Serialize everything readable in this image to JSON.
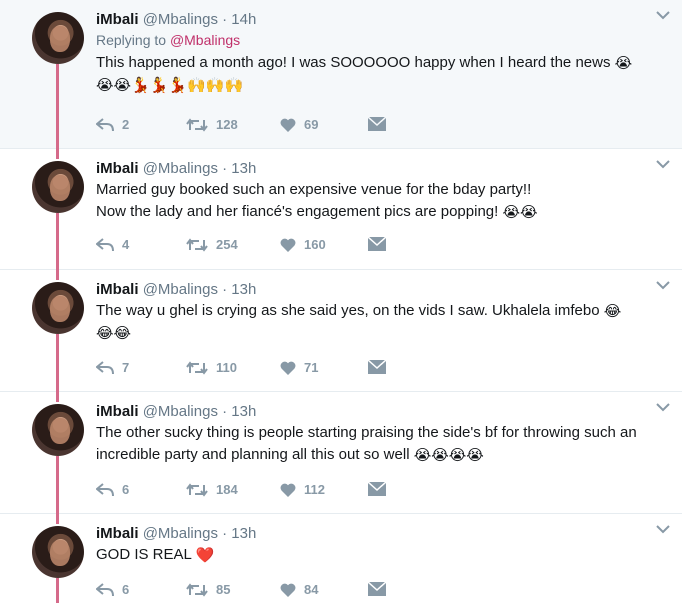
{
  "colors": {
    "thread": "#d56a8a",
    "muted": "#657786",
    "action": "#8899a6",
    "link": "#c0306a"
  },
  "tweets": [
    {
      "name": "iMbali",
      "handle": "@Mbalings",
      "time": "14h",
      "replying_label": "Replying to",
      "replying_to": "@Mbalings",
      "text1": "This happened a month ago! I was SOOOOOO happy when I heard the news",
      "emoji1": "😭",
      "emoji2": "😭😭💃💃💃🙌🙌🙌",
      "replies": "2",
      "retweets": "128",
      "likes": "69"
    },
    {
      "name": "iMbali",
      "handle": "@Mbalings",
      "time": "13h",
      "line1": "Married guy booked such an expensive venue for the bday party!!",
      "line2": "Now the lady and her fiancé's engagement pics are popping!",
      "emoji": "😭😭",
      "replies": "4",
      "retweets": "254",
      "likes": "160"
    },
    {
      "name": "iMbali",
      "handle": "@Mbalings",
      "time": "13h",
      "text1": "The way u ghel is crying as she said yes, on the vids I saw. Ukhalela imfebo",
      "emoji1": "😂",
      "emoji2": "😂😂",
      "replies": "7",
      "retweets": "110",
      "likes": "71"
    },
    {
      "name": "iMbali",
      "handle": "@Mbalings",
      "time": "13h",
      "line1": "The other sucky thing is people starting praising the side's bf for throwing such an",
      "line2": "incredible party and planning all this out so well",
      "emoji": "😭😭😭😭",
      "replies": "6",
      "retweets": "184",
      "likes": "112"
    },
    {
      "name": "iMbali",
      "handle": "@Mbalings",
      "time": "13h",
      "text": "GOD IS REAL",
      "emoji": "❤️",
      "replies": "6",
      "retweets": "85",
      "likes": "84"
    }
  ]
}
